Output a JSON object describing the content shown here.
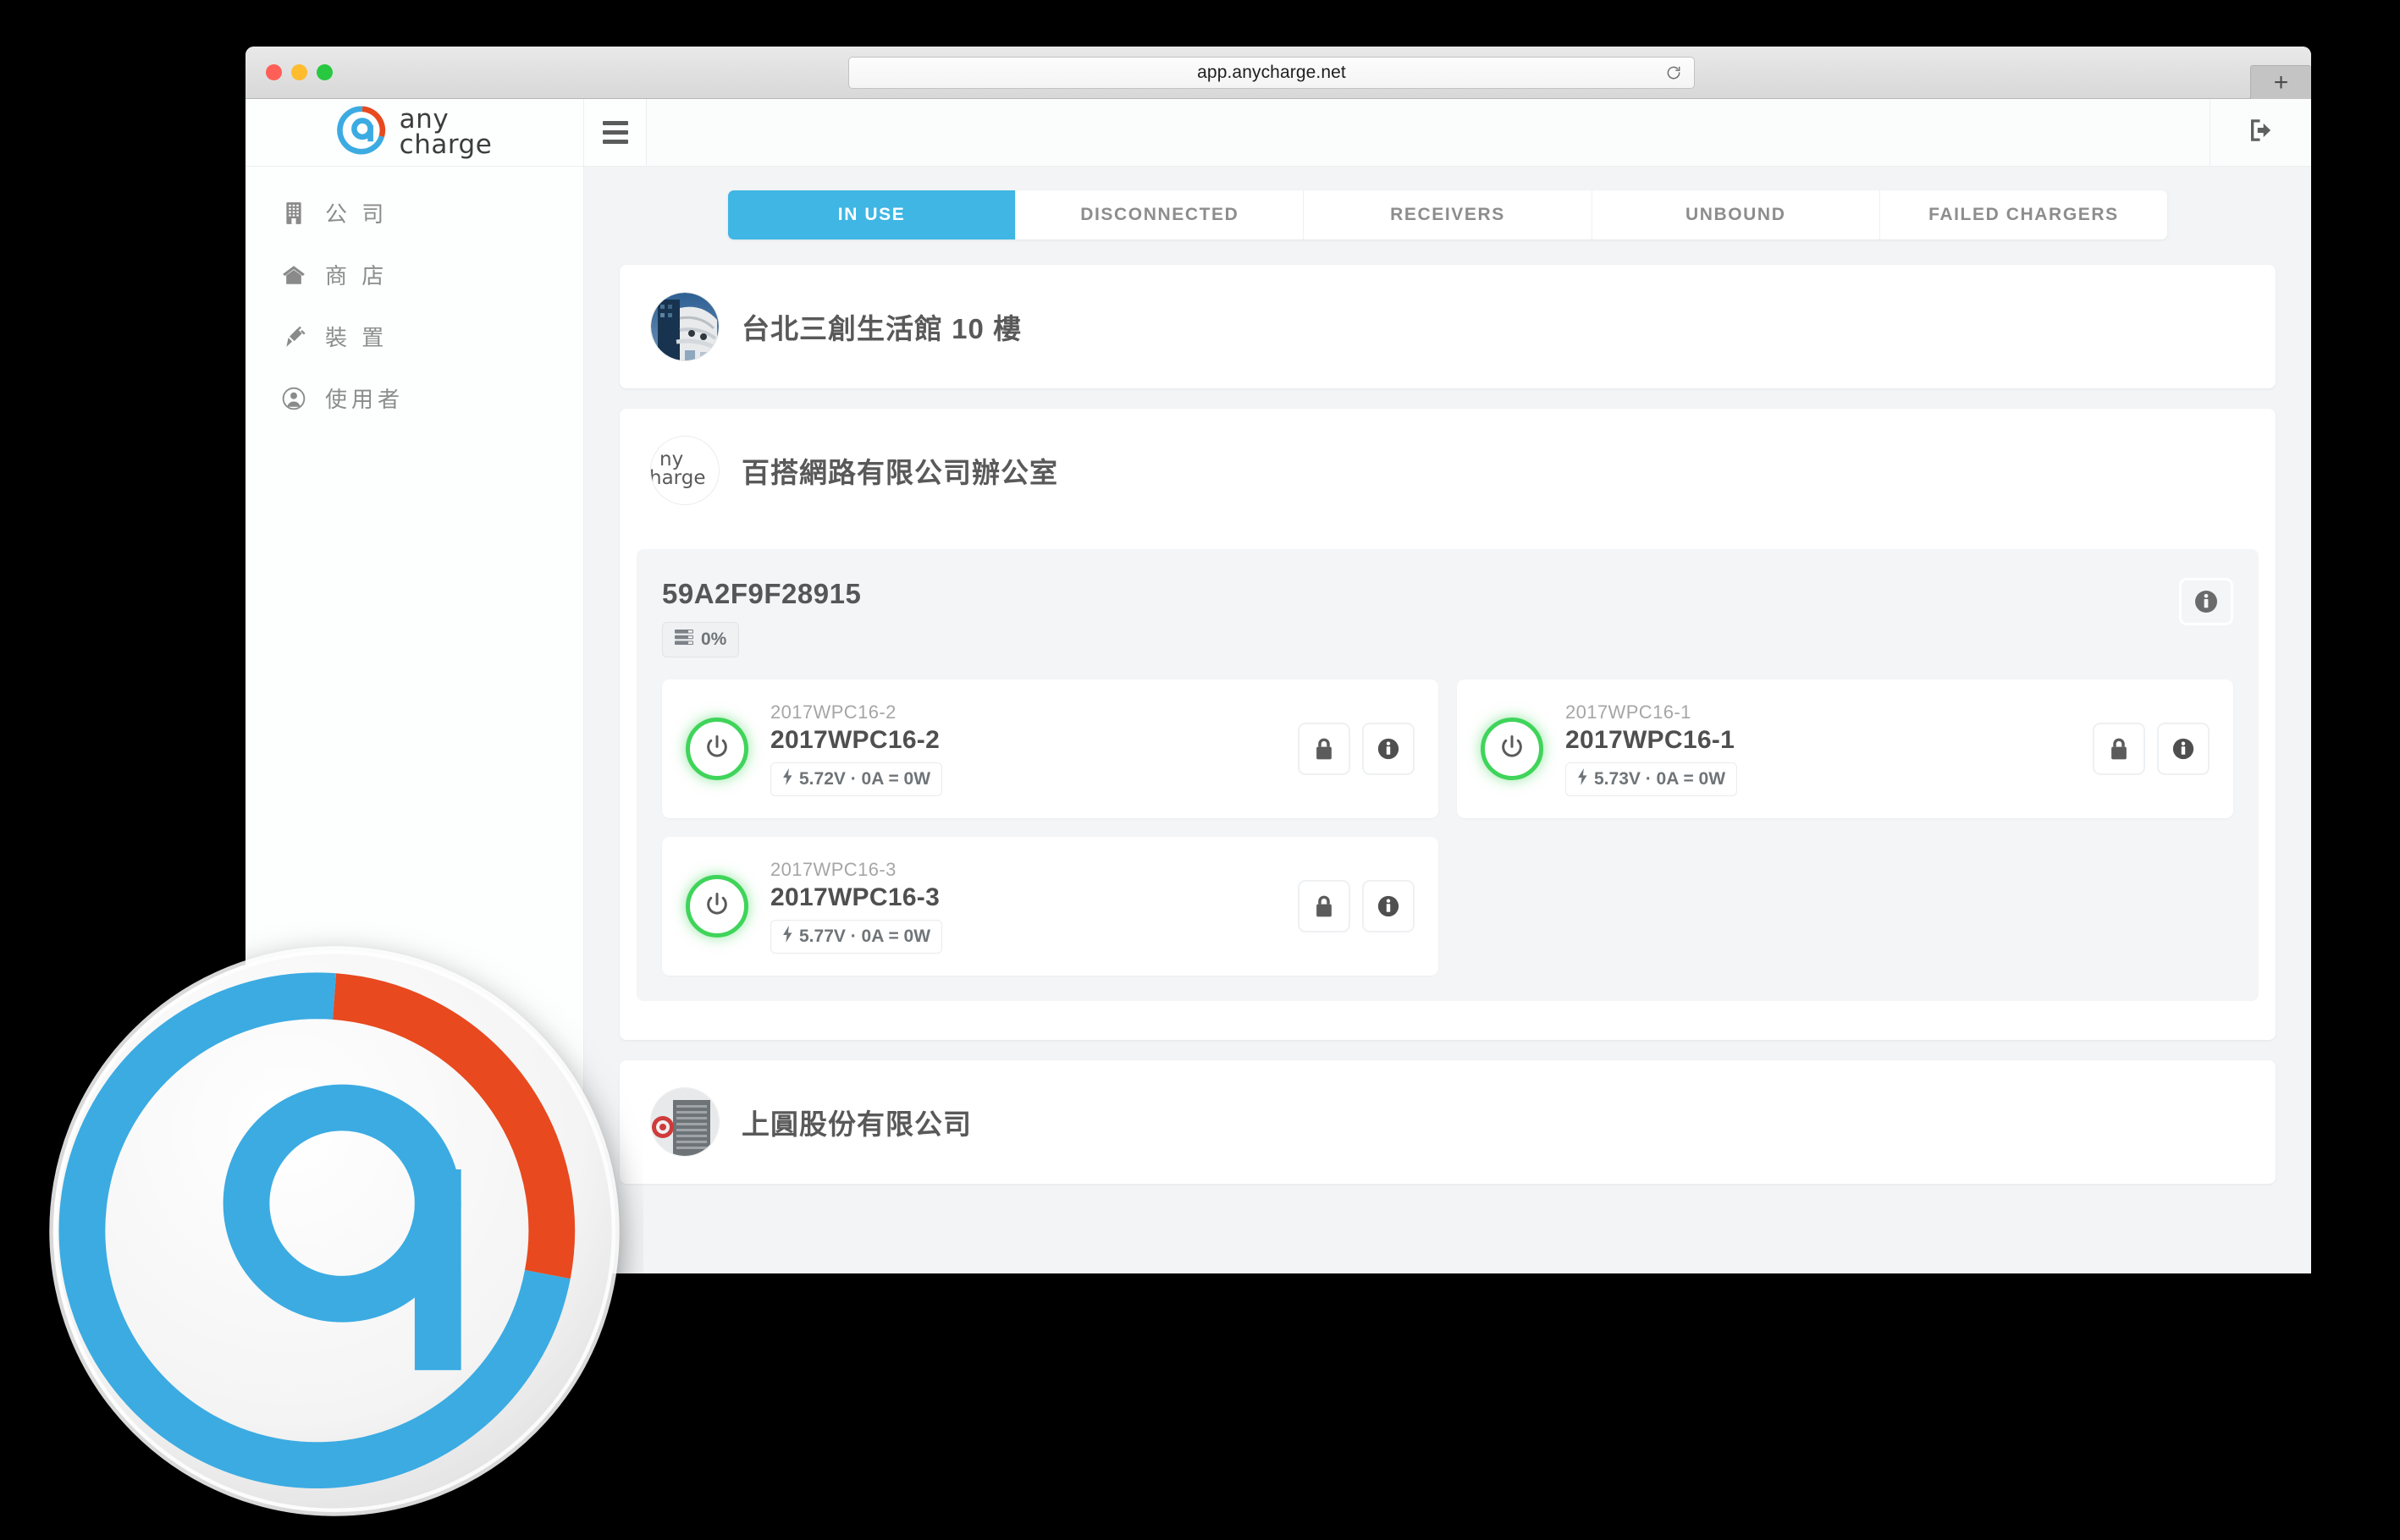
{
  "browser": {
    "url": "app.anycharge.net",
    "reload_icon": "reload-icon",
    "new_tab_label": "+",
    "traffic_lights": [
      "close",
      "minimize",
      "zoom"
    ]
  },
  "app": {
    "brand": {
      "line1": "any",
      "line2": "charge",
      "logo_orange": "#e8491f",
      "logo_blue": "#3babe2"
    },
    "menu_button": "hamburger-icon",
    "logout_button": "sign-out-icon",
    "accent_color": "#3fb6e3",
    "status_green": "#3fd45a"
  },
  "sidebar": {
    "items": [
      {
        "label": "公 司",
        "icon": "building-icon"
      },
      {
        "label": "商 店",
        "icon": "home-icon"
      },
      {
        "label": "裝 置",
        "icon": "plug-icon"
      },
      {
        "label": "使用者",
        "icon": "user-icon"
      }
    ]
  },
  "tabs": [
    {
      "label": "IN USE",
      "active": true
    },
    {
      "label": "DISCONNECTED",
      "active": false
    },
    {
      "label": "RECEIVERS",
      "active": false
    },
    {
      "label": "UNBOUND",
      "active": false
    },
    {
      "label": "FAILED CHARGERS",
      "active": false
    }
  ],
  "locations": [
    {
      "name": "台北三創生活館 10 樓",
      "avatar": "building-photo"
    },
    {
      "name": "百搭網路有限公司辦公室",
      "avatar": "anycharge-logo"
    },
    {
      "name": "上圓股份有限公司",
      "avatar": "office-photo"
    }
  ],
  "group": {
    "serial": "59A2F9F28915",
    "load_percent": "0%",
    "load_icon": "server-bars-icon",
    "info_button": "info-icon"
  },
  "devices": [
    {
      "sub_label": "2017WPC16-2",
      "name": "2017WPC16-2",
      "power": "5.72V · 0A = 0W",
      "power_icon": "bolt-icon",
      "status": "on",
      "lock_button": "lock-icon",
      "info_button": "info-icon"
    },
    {
      "sub_label": "2017WPC16-1",
      "name": "2017WPC16-1",
      "power": "5.73V · 0A = 0W",
      "power_icon": "bolt-icon",
      "status": "on",
      "lock_button": "lock-icon",
      "info_button": "info-icon"
    },
    {
      "sub_label": "2017WPC16-3",
      "name": "2017WPC16-3",
      "power": "5.77V · 0A = 0W",
      "power_icon": "bolt-icon",
      "status": "on",
      "lock_button": "lock-icon",
      "info_button": "info-icon"
    }
  ]
}
